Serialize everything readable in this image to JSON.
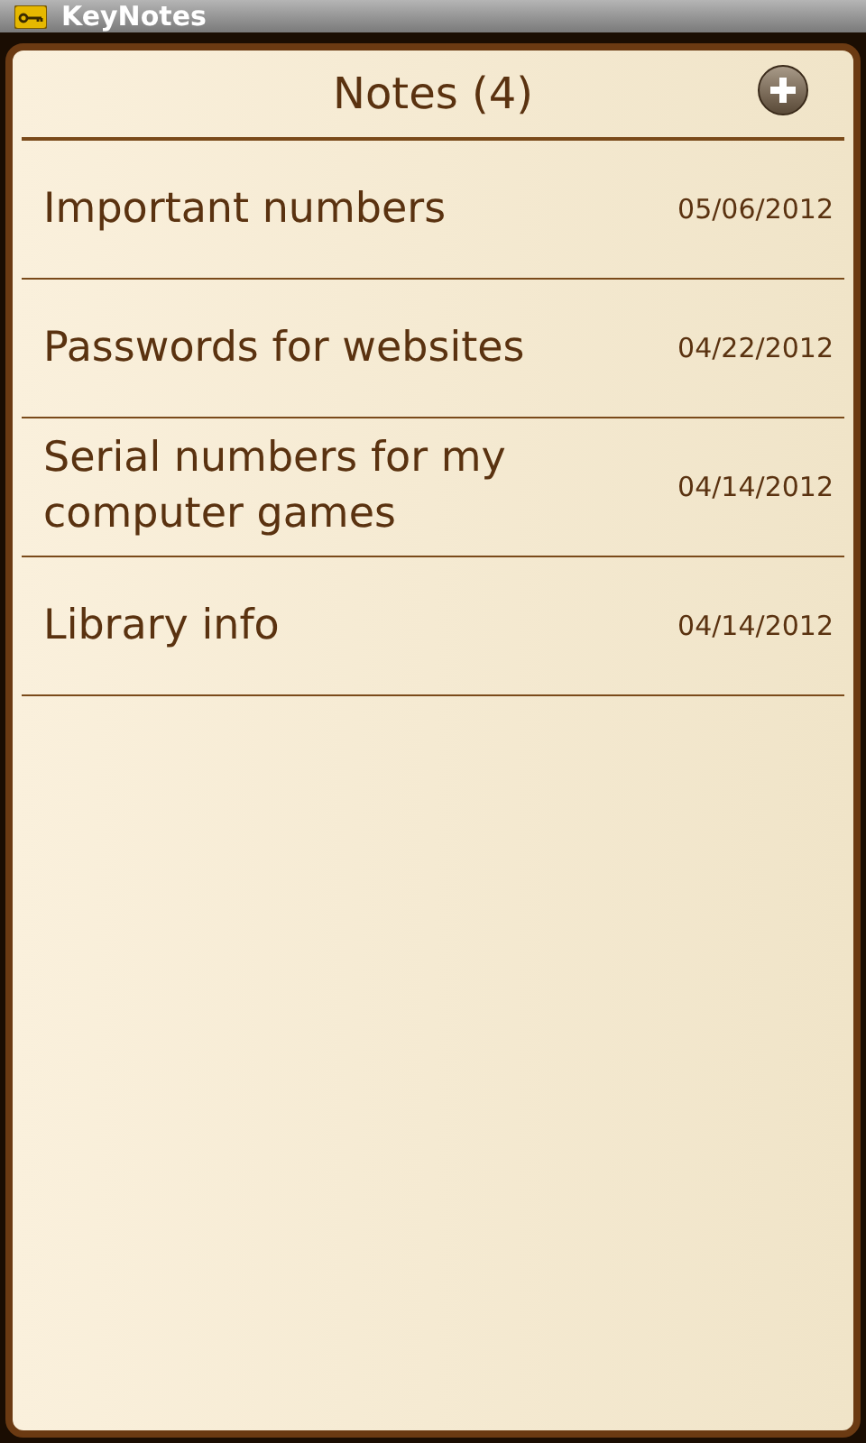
{
  "window": {
    "title": "KeyNotes"
  },
  "header": {
    "title": "Notes (4)"
  },
  "notes": [
    {
      "title": "Important numbers",
      "date": "05/06/2012"
    },
    {
      "title": "Passwords for websites",
      "date": "04/22/2012"
    },
    {
      "title": "Serial numbers for my computer games",
      "date": "04/14/2012"
    },
    {
      "title": "Library info",
      "date": "04/14/2012"
    }
  ]
}
